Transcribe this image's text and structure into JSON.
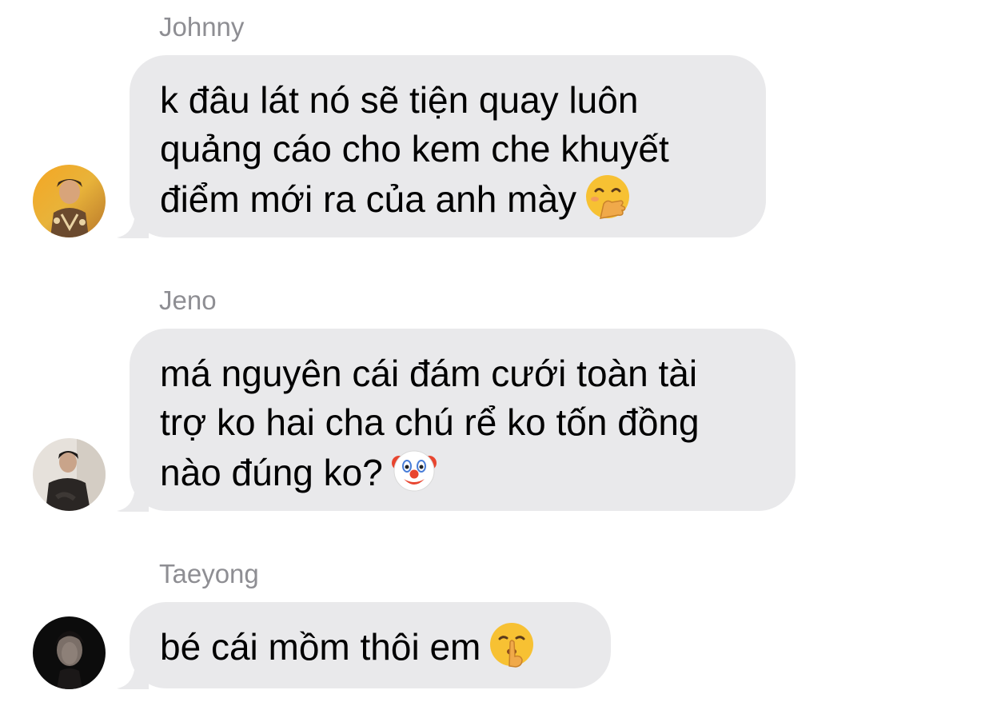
{
  "messages": [
    {
      "sender": "Johnny",
      "lines": [
        "k đâu lát nó sẽ tiện quay luôn",
        "quảng cáo cho kem che khuyết",
        "điểm mới ra của anh mày"
      ],
      "emoji": "hand-over-mouth-emoji"
    },
    {
      "sender": "Jeno",
      "lines": [
        "má nguyên cái đám cưới toàn tài",
        "trợ ko hai cha chú rể ko tốn đồng",
        "nào đúng ko?"
      ],
      "emoji": "clown-face-emoji"
    },
    {
      "sender": "Taeyong",
      "lines": [
        "bé cái mồm thôi em"
      ],
      "emoji": "shushing-face-emoji"
    }
  ],
  "colors": {
    "bubble": "#e9e9eb",
    "sender_name": "#8e8e93",
    "text": "#000000",
    "emoji_yellow": "#f7c133"
  }
}
